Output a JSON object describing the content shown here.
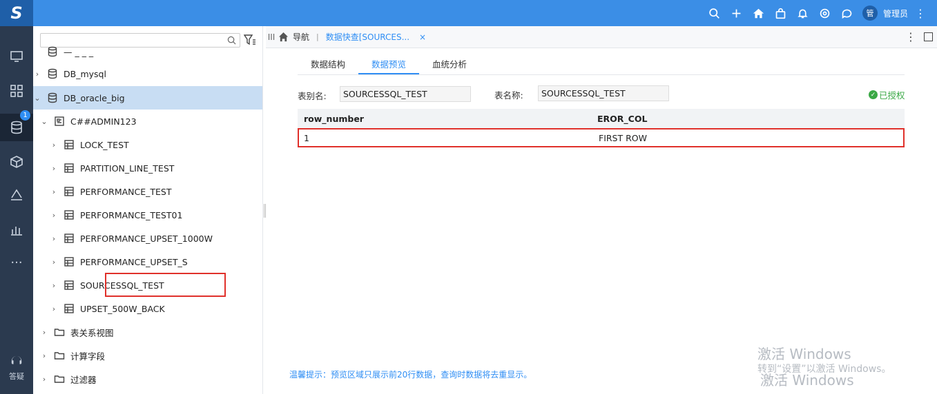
{
  "app": {
    "logo": "S"
  },
  "topbar": {
    "avatar_text": "管",
    "username": "管理员"
  },
  "rail": {
    "badge": "1",
    "help_label": "答疑"
  },
  "tree": {
    "rows": [
      {
        "label": "— _ _ _",
        "level": 0,
        "icon": "database",
        "arrow": ""
      },
      {
        "label": "DB_mysql",
        "level": 1,
        "icon": "database",
        "arrow": "›"
      },
      {
        "label": "DB_oracle_big",
        "level": 1,
        "icon": "database",
        "arrow": "⌄"
      },
      {
        "label": "C##ADMIN123",
        "level": 2,
        "icon": "schema",
        "arrow": "⌄"
      },
      {
        "label": "LOCK_TEST",
        "level": 3,
        "icon": "table",
        "arrow": "›"
      },
      {
        "label": "PARTITION_LINE_TEST",
        "level": 3,
        "icon": "table",
        "arrow": "›"
      },
      {
        "label": "PERFORMANCE_TEST",
        "level": 3,
        "icon": "table",
        "arrow": "›"
      },
      {
        "label": "PERFORMANCE_TEST01",
        "level": 3,
        "icon": "table",
        "arrow": "›"
      },
      {
        "label": "PERFORMANCE_UPSET_1000W",
        "level": 3,
        "icon": "table",
        "arrow": "›"
      },
      {
        "label": "PERFORMANCE_UPSET_S",
        "level": 3,
        "icon": "table",
        "arrow": "›"
      },
      {
        "label": "SOURCESSQL_TEST",
        "level": 3,
        "icon": "table",
        "arrow": "›"
      },
      {
        "label": "UPSET_500W_BACK",
        "level": 3,
        "icon": "table",
        "arrow": "›"
      },
      {
        "label": "表关系视图",
        "level": 2,
        "icon": "folder",
        "arrow": "›"
      },
      {
        "label": "计算字段",
        "level": 2,
        "icon": "folder",
        "arrow": "›"
      },
      {
        "label": "过滤器",
        "level": 2,
        "icon": "folder",
        "arrow": "›"
      }
    ]
  },
  "tabbar": {
    "grip": "III",
    "nav_label": "导航",
    "sep": "|",
    "active_tab": "数据快查[SOURCES...",
    "close": "×",
    "more": "⋮"
  },
  "subtabs": [
    "数据结构",
    "数据预览",
    "血统分析"
  ],
  "fields": {
    "alias_label": "表别名:",
    "alias_value": "SOURCESSQL_TEST",
    "name_label": "表名称:",
    "name_value": "SOURCESSQL_TEST",
    "authorized": "已授权"
  },
  "table": {
    "columns": [
      "row_number",
      "EROR_COL"
    ],
    "rows": [
      [
        "1",
        "FIRST ROW"
      ]
    ]
  },
  "tip": "温馨提示：预览区域只展示前20行数据，查询时数据将去重显示。",
  "watermark": {
    "line1": "激活 Windows",
    "line2": "转到“设置”以激活 Windows。"
  }
}
